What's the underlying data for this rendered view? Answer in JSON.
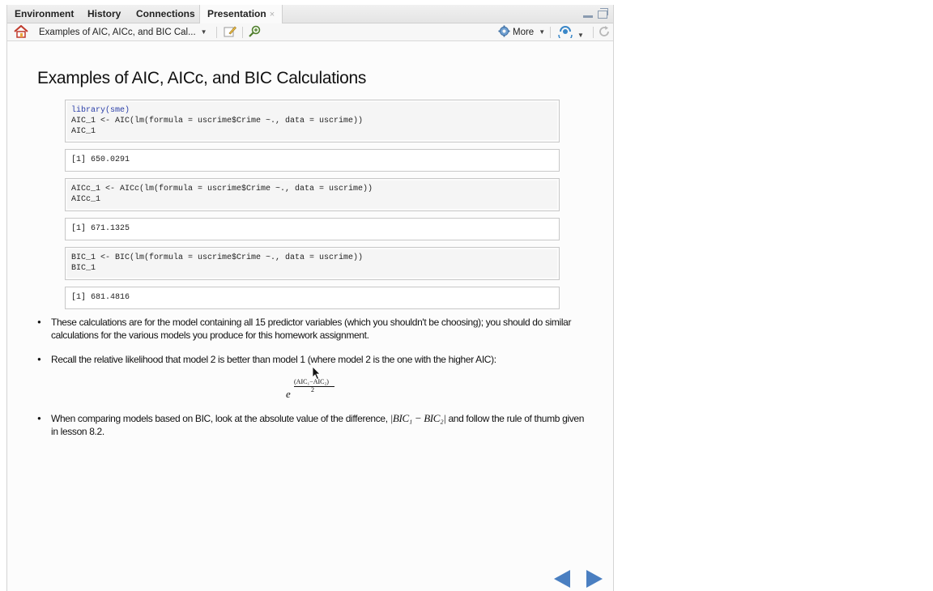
{
  "tabs": [
    {
      "label": "Environment"
    },
    {
      "label": "History"
    },
    {
      "label": "Connections"
    },
    {
      "label": "Presentation",
      "close": "×"
    }
  ],
  "toolbar": {
    "slide_select": "Examples of AIC, AICc, and BIC Cal...",
    "more_label": "More",
    "icons": [
      "home-icon",
      "edit-icon",
      "zoom-icon",
      "gear-icon",
      "publish-icon",
      "refresh-icon"
    ]
  },
  "slide": {
    "title": "Examples of AIC, AICc, and BIC Calculations",
    "code_blocks": [
      {
        "kind": "source",
        "lines": [
          "library(sme)",
          "AIC_1 <- AIC(lm(formula = uscrime$Crime ~., data = uscrime))",
          "AIC_1"
        ]
      },
      {
        "kind": "output",
        "lines": [
          "[1] 650.0291"
        ]
      },
      {
        "kind": "source",
        "lines": [
          "AICc_1 <- AICc(lm(formula = uscrime$Crime ~., data = uscrime))",
          "AICc_1"
        ]
      },
      {
        "kind": "output",
        "lines": [
          "[1] 671.1325"
        ]
      },
      {
        "kind": "source",
        "lines": [
          "BIC_1 <- BIC(lm(formula = uscrime$Crime ~., data = uscrime))",
          "BIC_1"
        ]
      },
      {
        "kind": "output",
        "lines": [
          "[1] 681.4816"
        ]
      }
    ],
    "bullets": {
      "b1": "These calculations are for the model containing all 15 predictor variables (which you shouldn't be choosing); you should do similar calculations for the various models you produce for this homework assignment.",
      "b2": "Recall the relative likelihood that model 2 is better than model 1 (where model 2 is the one with the higher AIC):",
      "b3_pre": "When comparing models based on BIC, look at the absolute value of the difference, ",
      "b3_math": "|BIC₁ − BIC₂|",
      "b3_post": " and follow the rule of thumb given in lesson 8.2."
    },
    "formula": {
      "base": "e",
      "numerator": "(AIC₁−AIC₂)",
      "denominator": "2"
    }
  },
  "colors": {
    "nav_arrow": "#4a7fc1",
    "tab_bar": "#e8e8e8",
    "code_keyword": "#2a3ea8"
  }
}
